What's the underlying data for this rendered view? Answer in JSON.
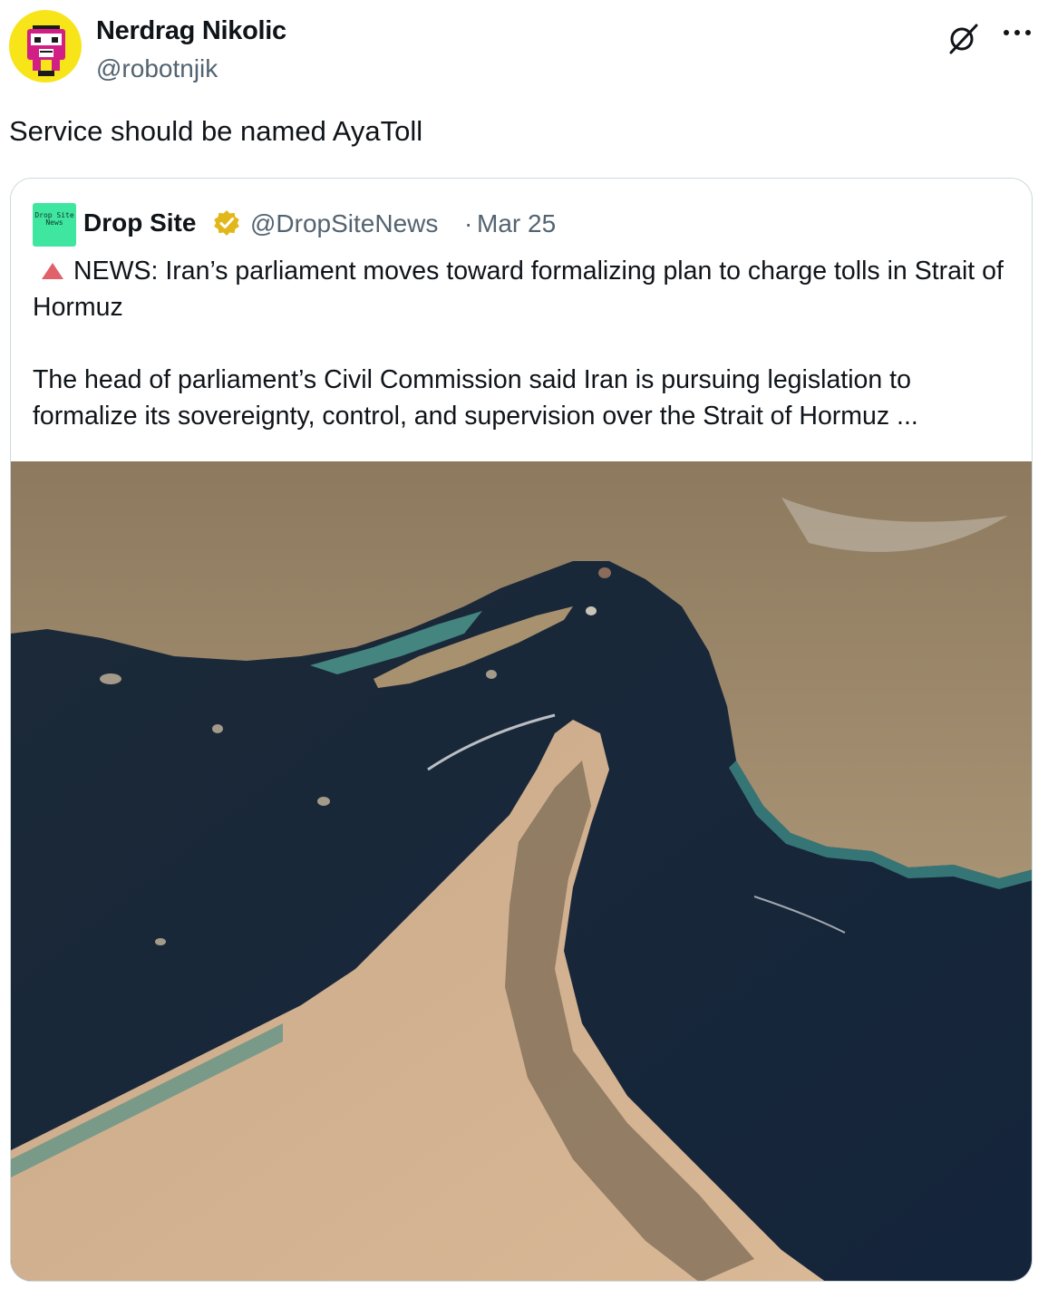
{
  "tweet": {
    "author_name": "Nerdrag Nikolic",
    "author_handle": "@robotnjik",
    "text": "Service should be named AyaToll",
    "icons": {
      "avatar": "ninja-robot-avatar",
      "grok": "grok-slash-icon",
      "more": "more-dots-icon"
    }
  },
  "quote": {
    "author_name": "Drop Site",
    "avatar_text": "Drop Site News",
    "verified_color": "#e2b719",
    "author_handle": "@DropSiteNews",
    "separator": "·",
    "date": "Mar 25",
    "line1": "NEWS: Iran’s parliament moves toward formalizing plan to charge tolls in Strait of Hormuz",
    "line2": "The head of parliament’s Civil Commission said Iran is pursuing legislation to formalize its sovereignty, control, and supervision over the Strait of Hormuz ...",
    "alert_icon": "red-triangle-icon",
    "media": "satellite-image-strait-of-hormuz"
  },
  "colors": {
    "text": "#0f1419",
    "secondary": "#536471",
    "border": "#cfd9de",
    "avatar_bg": "#f7e51a",
    "quote_avatar_bg": "#3ee6a0",
    "alert": "#e0616a"
  }
}
